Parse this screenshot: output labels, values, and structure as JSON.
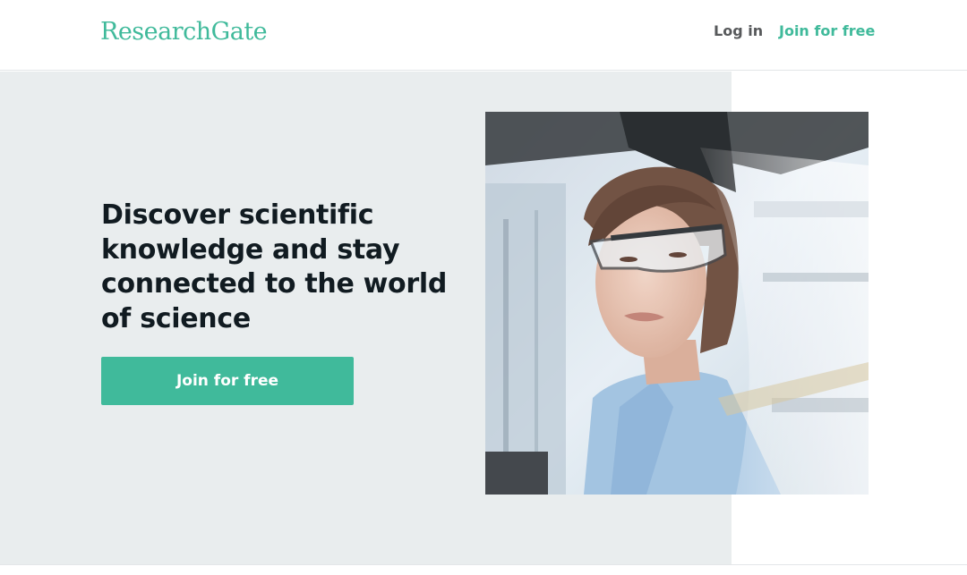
{
  "header": {
    "logo_text": "ResearchGate",
    "login_label": "Log in",
    "join_label": "Join for free"
  },
  "hero": {
    "headline": "Discover scientific knowledge and stay connected to the world of science",
    "cta_label": "Join for free",
    "photo": "scientist-in-lab-photo"
  },
  "colors": {
    "brand": "#40ba9b",
    "hero_background": "#e9edee",
    "headline_text": "#111b21",
    "nav_text": "#57595b"
  }
}
